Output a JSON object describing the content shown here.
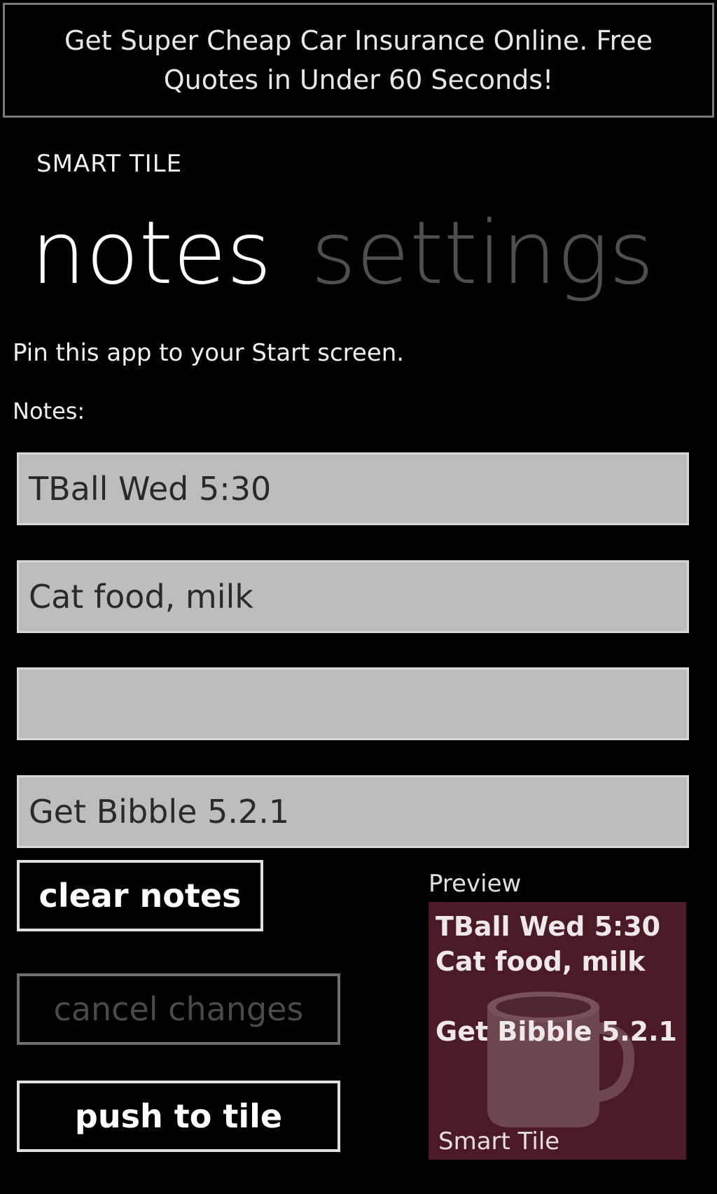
{
  "ad": {
    "text": "Get Super Cheap Car Insurance Online. Free Quotes in Under 60 Seconds!"
  },
  "app": {
    "title": "SMART TILE"
  },
  "pivot": {
    "items": [
      {
        "label": "notes",
        "active": true
      },
      {
        "label": "settings",
        "active": false
      }
    ]
  },
  "main": {
    "hint": "Pin this app to your Start screen.",
    "notes_label": "Notes:",
    "notes": [
      {
        "value": "TBall Wed 5:30"
      },
      {
        "value": "Cat food, milk"
      },
      {
        "value": ""
      },
      {
        "value": "Get Bibble 5.2.1"
      }
    ]
  },
  "buttons": {
    "clear_label": "clear notes",
    "cancel_label": "cancel changes",
    "push_label": "push to tile"
  },
  "preview": {
    "label": "Preview",
    "tile_color": "#4a1b26",
    "icon": "mug-icon",
    "lines": [
      "TBall Wed 5:30",
      "Cat food, milk",
      "",
      "Get Bibble 5.2.1"
    ],
    "tile_name": "Smart Tile"
  }
}
